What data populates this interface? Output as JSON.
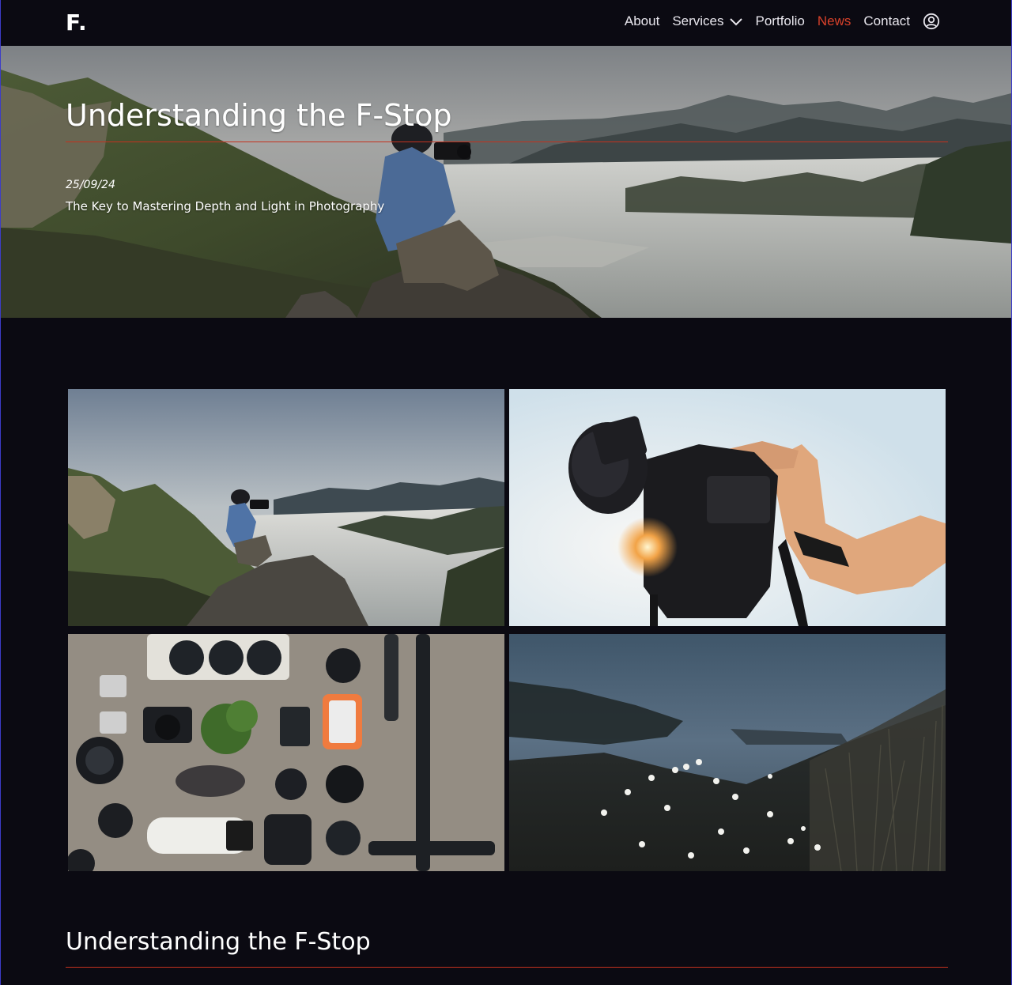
{
  "nav": {
    "logo": "F.",
    "links": [
      {
        "label": "About",
        "active": false
      },
      {
        "label": "Services",
        "active": false,
        "has_dropdown": true
      },
      {
        "label": "Portfolio",
        "active": false
      },
      {
        "label": "News",
        "active": true
      },
      {
        "label": "Contact",
        "active": false
      }
    ],
    "account_icon": "user-circle-icon"
  },
  "hero": {
    "title": "Understanding the F-Stop",
    "date": "25/09/24",
    "subtitle": "The Key to Mastering Depth and Light in Photography"
  },
  "gallery": {
    "images": [
      {
        "subject": "photographer on mountain above clouds"
      },
      {
        "subject": "hand holding camera against sun"
      },
      {
        "subject": "flat lay of camera gear"
      },
      {
        "subject": "wildflowers by the sea"
      }
    ]
  },
  "section": {
    "title": "Understanding the F-Stop"
  },
  "colors": {
    "background": "#0b0a12",
    "accent": "#d8412a",
    "rule": "#c4311e",
    "text": "#ffffff"
  }
}
